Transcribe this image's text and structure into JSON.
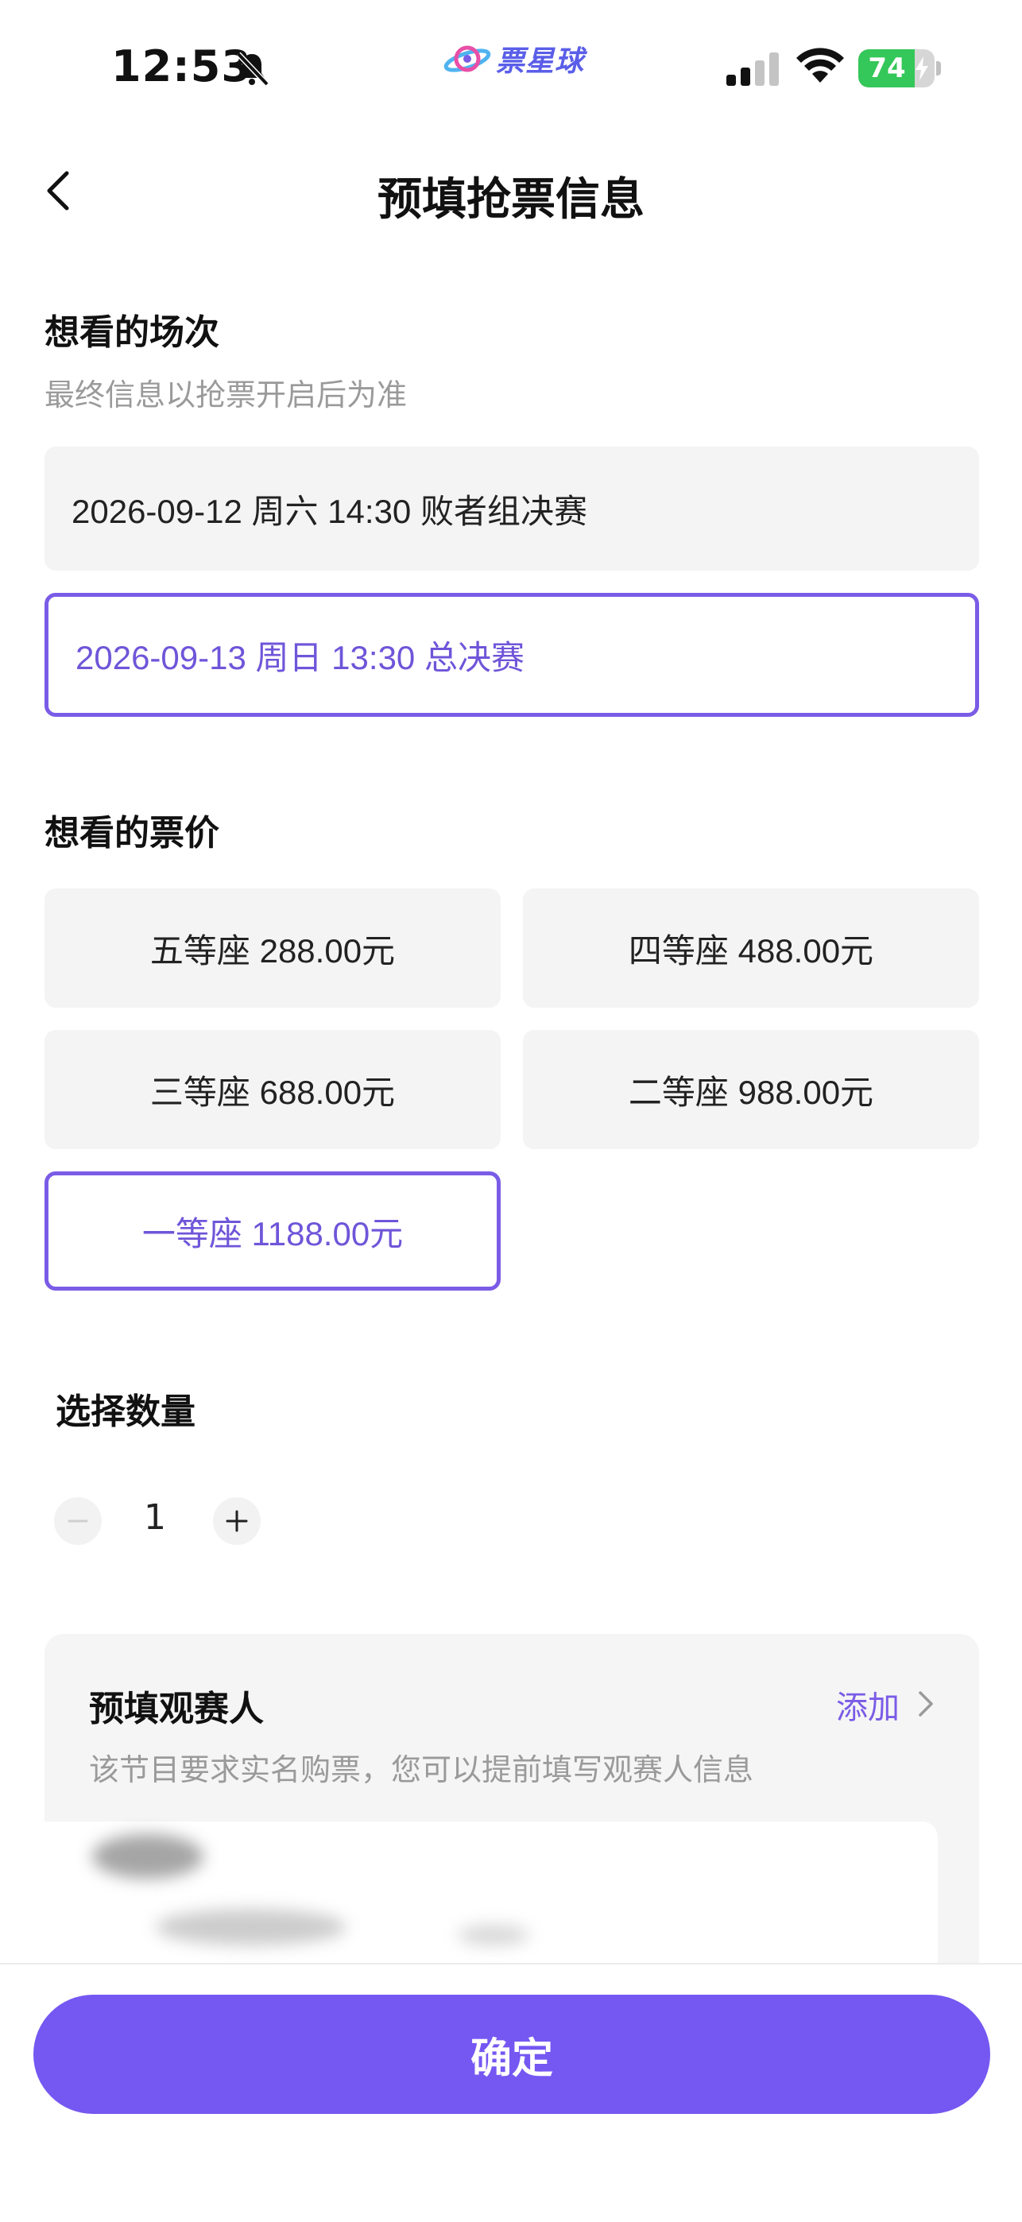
{
  "status_bar": {
    "time": "12:53",
    "battery": 74,
    "battery_text": "74",
    "app_name": "票星球"
  },
  "nav": {
    "title": "预填抢票信息"
  },
  "sessions": {
    "title": "想看的场次",
    "subtitle": "最终信息以抢票开启后为准",
    "options": [
      {
        "label": "2026-09-12 周六 14:30 败者组决赛",
        "selected": false
      },
      {
        "label": "2026-09-13 周日 13:30 总决赛",
        "selected": true
      }
    ]
  },
  "prices": {
    "title": "想看的票价",
    "options": [
      {
        "label": "五等座 288.00元",
        "selected": false
      },
      {
        "label": "四等座 488.00元",
        "selected": false
      },
      {
        "label": "三等座 688.00元",
        "selected": false
      },
      {
        "label": "二等座 988.00元",
        "selected": false
      },
      {
        "label": "一等座 1188.00元",
        "selected": true
      }
    ]
  },
  "quantity": {
    "title": "选择数量",
    "value": "1"
  },
  "attendee": {
    "title": "预填观赛人",
    "add_label": "添加",
    "subtitle": "该节目要求实名购票，您可以提前填写观赛人信息"
  },
  "footer": {
    "confirm_label": "确定"
  },
  "colors": {
    "accent": "#7557f2",
    "selected_border": "#7a5ce6",
    "option_bg": "#f4f4f4",
    "battery_green": "#34c759"
  },
  "icons": {
    "mute": "bell-slash-icon",
    "back": "chevron-left-icon",
    "add_chevron": "chevron-right-icon",
    "minus": "minus-icon",
    "plus": "plus-icon"
  }
}
